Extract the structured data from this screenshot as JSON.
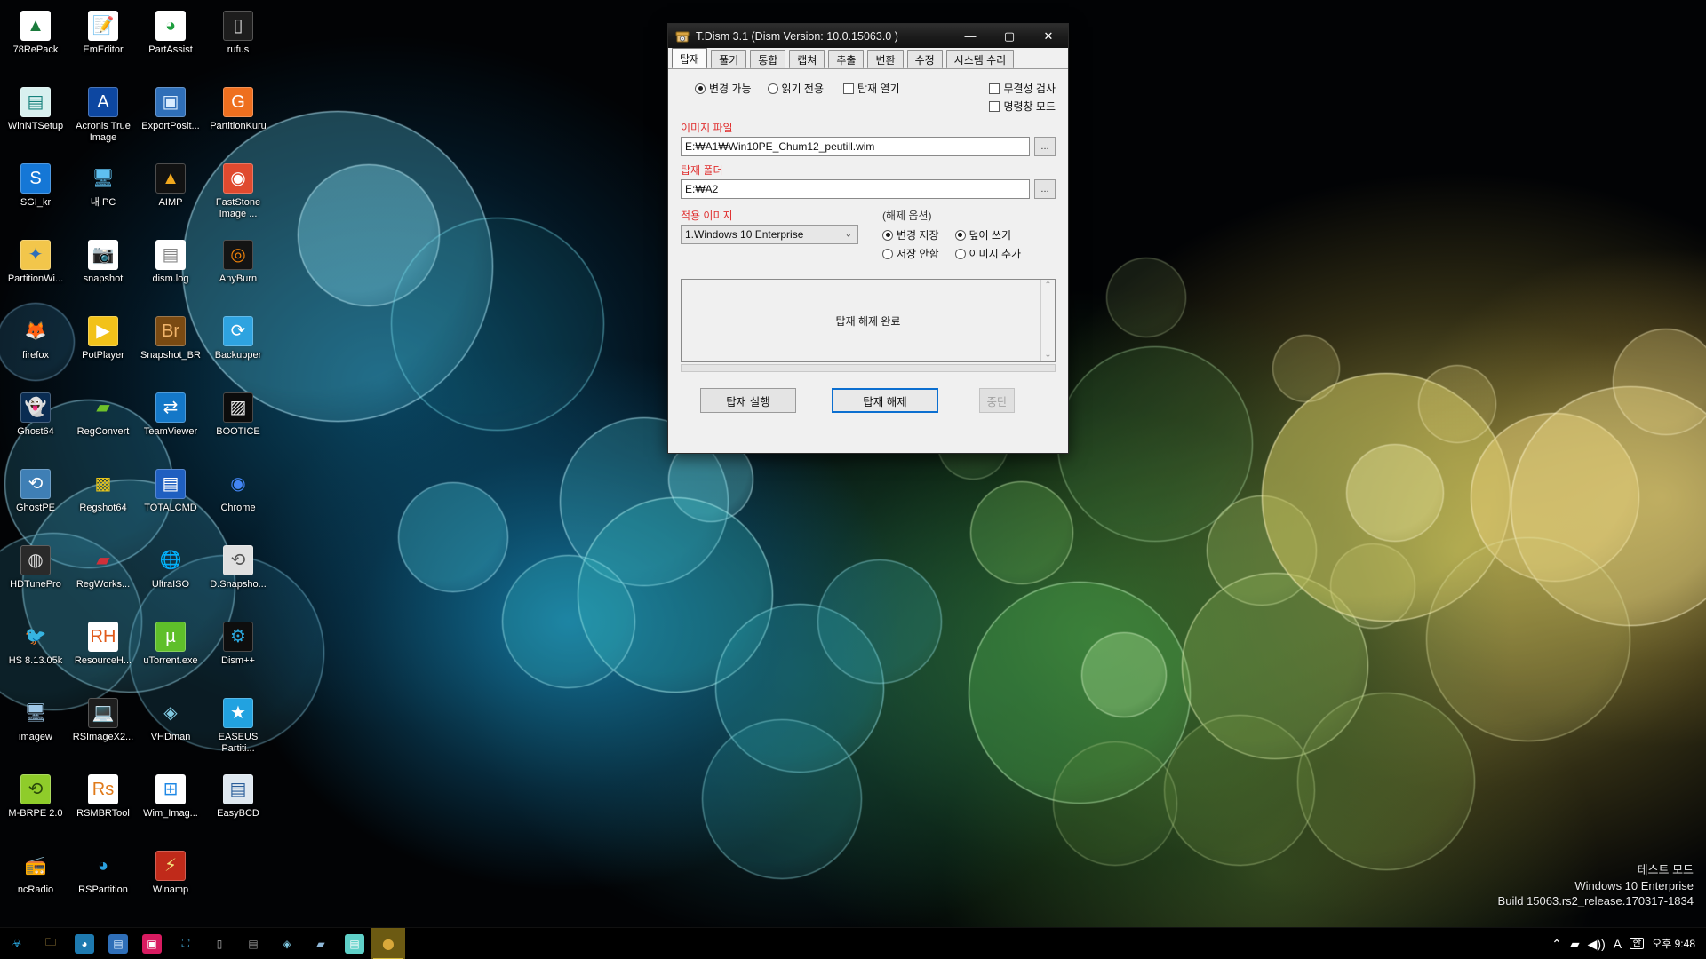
{
  "desktop": {
    "icons": [
      {
        "label": "78RePack",
        "icon": "triangle-logo-icon",
        "bg": "#ffffff",
        "fg": "#1b7a3c",
        "glyph": "▲"
      },
      {
        "label": "EmEditor",
        "icon": "notepad-pencil-icon",
        "bg": "#ffffff",
        "fg": "#2a5ea8",
        "glyph": "📝"
      },
      {
        "label": "PartAssist",
        "icon": "partition-pie-icon",
        "bg": "#ffffff",
        "fg": "#1e9e3e",
        "glyph": "◕"
      },
      {
        "label": "rufus",
        "icon": "usb-drive-icon",
        "bg": "#1d1d1d",
        "fg": "#dddddd",
        "glyph": "▯"
      },
      {
        "label": "WinNTSetup",
        "icon": "setup-book-icon",
        "bg": "#d8f0ef",
        "fg": "#17827d",
        "glyph": "▤"
      },
      {
        "label": "Acronis True Image",
        "icon": "acronis-a-icon",
        "bg": "#0d47a1",
        "fg": "#ffffff",
        "glyph": "A"
      },
      {
        "label": "ExportPosit...",
        "icon": "monitor-window-icon",
        "bg": "#2f6fb8",
        "fg": "#d8ecff",
        "glyph": "▣"
      },
      {
        "label": "PartitionKuru",
        "icon": "gparted-g-icon",
        "bg": "#ee6f1f",
        "fg": "#ffffff",
        "glyph": "G"
      },
      {
        "label": "SGI_kr",
        "icon": "sgi-s-circle-icon",
        "bg": "#1577d6",
        "fg": "#ffffff",
        "glyph": "S"
      },
      {
        "label": "내 PC",
        "icon": "this-pc-icon",
        "bg": "transparent",
        "fg": "#5fc0f0",
        "glyph": "🖥"
      },
      {
        "label": "AIMP",
        "icon": "aimp-triangle-icon",
        "bg": "#121212",
        "fg": "#f2a81d",
        "glyph": "▲"
      },
      {
        "label": "FastStone Image ...",
        "icon": "faststone-eye-icon",
        "bg": "#e04a2f",
        "fg": "#ffffff",
        "glyph": "◉"
      },
      {
        "label": "PartitionWi...",
        "icon": "partition-wizard-icon",
        "bg": "#f2c64b",
        "fg": "#2f6fb8",
        "glyph": "✦"
      },
      {
        "label": "snapshot",
        "icon": "snapshot-camera-icon",
        "bg": "#ffffff",
        "fg": "#2a3f8f",
        "glyph": "📷"
      },
      {
        "label": "dism.log",
        "icon": "text-log-file-icon",
        "bg": "#ffffff",
        "fg": "#888888",
        "glyph": "▤"
      },
      {
        "label": "AnyBurn",
        "icon": "anyburn-disc-icon",
        "bg": "#141414",
        "fg": "#f0820a",
        "glyph": "◎"
      },
      {
        "label": "firefox",
        "icon": "firefox-icon",
        "bg": "transparent",
        "fg": "#f08020",
        "glyph": "🦊"
      },
      {
        "label": "PotPlayer",
        "icon": "potplayer-play-icon",
        "bg": "#f2c21a",
        "fg": "#ffffff",
        "glyph": "▶"
      },
      {
        "label": "Snapshot_BR",
        "icon": "bridge-br-icon",
        "bg": "#7a4a12",
        "fg": "#f2b46a",
        "glyph": "Br"
      },
      {
        "label": "Backupper",
        "icon": "backupper-icon",
        "bg": "#2ea3e0",
        "fg": "#ffffff",
        "glyph": "⟳"
      },
      {
        "label": "Ghost64",
        "icon": "ghost-icon",
        "bg": "#0a2c52",
        "fg": "#f2f2d0",
        "glyph": "👻"
      },
      {
        "label": "RegConvert",
        "icon": "reg-cubes-icon",
        "bg": "transparent",
        "fg": "#6fc12a",
        "glyph": "▰"
      },
      {
        "label": "TeamViewer",
        "icon": "teamviewer-icon",
        "bg": "#1478c8",
        "fg": "#ffffff",
        "glyph": "⇄"
      },
      {
        "label": "BOOTICE",
        "icon": "bootice-disk-icon",
        "bg": "#0c0c0c",
        "fg": "#e8e8e8",
        "glyph": "▨"
      },
      {
        "label": "GhostPE",
        "icon": "ghostpe-drive-icon",
        "bg": "#3f7fb5",
        "fg": "#ffffff",
        "glyph": "⟲"
      },
      {
        "label": "Regshot64",
        "icon": "regshot-icon",
        "bg": "transparent",
        "fg": "#e8c41a",
        "glyph": "▩"
      },
      {
        "label": "TOTALCMD",
        "icon": "totalcmd-floppy-icon",
        "bg": "#1f5fc0",
        "fg": "#ffffff",
        "glyph": "▤"
      },
      {
        "label": "Chrome",
        "icon": "chrome-icon",
        "bg": "transparent",
        "fg": "#4285f4",
        "glyph": "◉"
      },
      {
        "label": "HDTunePro",
        "icon": "hdtune-disk-icon",
        "bg": "#2a2a2a",
        "fg": "#d8d8d8",
        "glyph": "◍"
      },
      {
        "label": "RegWorks...",
        "icon": "regworkshop-icon",
        "bg": "transparent",
        "fg": "#d0303a",
        "glyph": "▰"
      },
      {
        "label": "UltraISO",
        "icon": "ultraiso-globe-icon",
        "bg": "transparent",
        "fg": "#1e88e5",
        "glyph": "🌐"
      },
      {
        "label": "D.Snapsho...",
        "icon": "drive-snapshot-icon",
        "bg": "#e0e0e0",
        "fg": "#555555",
        "glyph": "⟲"
      },
      {
        "label": "HS 8.13.05k",
        "icon": "hs-bird-icon",
        "bg": "transparent",
        "fg": "#a050c8",
        "glyph": "🐦"
      },
      {
        "label": "ResourceH...",
        "icon": "resource-hacker-icon",
        "bg": "#ffffff",
        "fg": "#e05a1a",
        "glyph": "RH"
      },
      {
        "label": "uTorrent.exe",
        "icon": "utorrent-icon",
        "bg": "#5fbf2a",
        "fg": "#ffffff",
        "glyph": "µ"
      },
      {
        "label": "Dism++",
        "icon": "dismpp-gears-icon",
        "bg": "#0e0e0e",
        "fg": "#2aa8e0",
        "glyph": "⚙"
      },
      {
        "label": "imagew",
        "icon": "imagew-monitor-icon",
        "bg": "transparent",
        "fg": "#9fc8e8",
        "glyph": "🖥"
      },
      {
        "label": "RSImageX2...",
        "icon": "rsimagex-laptop-icon",
        "bg": "#1e1e1e",
        "fg": "#7fb8e8",
        "glyph": "💻"
      },
      {
        "label": "VHDman",
        "icon": "vhdman-icon",
        "bg": "transparent",
        "fg": "#7fc8e0",
        "glyph": "◈"
      },
      {
        "label": "EASEUS Partiti...",
        "icon": "easeus-partition-icon",
        "bg": "#22a2e0",
        "fg": "#ffffff",
        "glyph": "★"
      },
      {
        "label": "M-BRPE 2.0",
        "icon": "mbrpe-disk-icon",
        "bg": "#8fcc2a",
        "fg": "#2a4a0a",
        "glyph": "⟲"
      },
      {
        "label": "RSMBRTool",
        "icon": "rsmbr-rs-icon",
        "bg": "#ffffff",
        "fg": "#e07a1a",
        "glyph": "Rs"
      },
      {
        "label": "Wim_Imag...",
        "icon": "wim-windows-icon",
        "bg": "#ffffff",
        "fg": "#1e88e5",
        "glyph": "⊞"
      },
      {
        "label": "EasyBCD",
        "icon": "easybcd-icon",
        "bg": "#dfe8f0",
        "fg": "#2a5e9a",
        "glyph": "▤"
      },
      {
        "label": "ncRadio",
        "icon": "gramophone-icon",
        "bg": "transparent",
        "fg": "#c8913a",
        "glyph": "📻"
      },
      {
        "label": "RSPartition",
        "icon": "rspartition-icon",
        "bg": "transparent",
        "fg": "#2aa0e0",
        "glyph": "◕"
      },
      {
        "label": "Winamp",
        "icon": "winamp-icon",
        "bg": "#c02a1a",
        "fg": "#f2e07a",
        "glyph": "⚡"
      }
    ],
    "watermark": {
      "line1": "테스트 모드",
      "line2": "Windows 10 Enterprise",
      "line3": "Build 15063.rs2_release.170317-1834"
    }
  },
  "taskbar": {
    "items": [
      {
        "name": "biohazard-icon",
        "glyph": "☣",
        "bg": "transparent",
        "fg": "#2aa8e0",
        "active": false
      },
      {
        "name": "file-explorer-icon",
        "glyph": "🗀",
        "bg": "transparent",
        "fg": "#f2c45a",
        "active": false
      },
      {
        "name": "q-dir-icon",
        "glyph": "◕",
        "bg": "#1e7ab0",
        "fg": "#ffffff",
        "active": false
      },
      {
        "name": "control-panel-icon",
        "glyph": "▤",
        "bg": "#2f6fb8",
        "fg": "#d8ecff",
        "active": false
      },
      {
        "name": "monitor-pink-icon",
        "glyph": "▣",
        "bg": "#d81b60",
        "fg": "#ffffff",
        "active": false
      },
      {
        "name": "selection-tool-icon",
        "glyph": "⛶",
        "bg": "transparent",
        "fg": "#4fc3f7",
        "active": false
      },
      {
        "name": "usb-device-icon",
        "glyph": "▯",
        "bg": "transparent",
        "fg": "#b0b0b0",
        "active": false
      },
      {
        "name": "drive-device-icon",
        "glyph": "▤",
        "bg": "transparent",
        "fg": "#9a9a9a",
        "active": false
      },
      {
        "name": "vhd-tool-icon",
        "glyph": "◈",
        "bg": "transparent",
        "fg": "#7fc8e0",
        "active": false
      },
      {
        "name": "network-disk-icon",
        "glyph": "▰",
        "bg": "transparent",
        "fg": "#8fb8d8",
        "active": false
      },
      {
        "name": "notepad-icon",
        "glyph": "▤",
        "bg": "#5fd0c8",
        "fg": "#ffffff",
        "active": false
      },
      {
        "name": "tdism-icon",
        "glyph": "⬤",
        "bg": "transparent",
        "fg": "#d8a83a",
        "active": true
      }
    ],
    "tray": {
      "chevron": "⌃",
      "battery": "▰",
      "volume": "◀))",
      "language_a": "A",
      "ime": "한",
      "time": "오후 9:48"
    }
  },
  "window": {
    "title": "T.Dism 3.1 (Dism Version: 10.0.15063.0 )",
    "icon": "tdism-app-icon",
    "controls": {
      "minimize": "—",
      "maximize": "▢",
      "close": "✕"
    },
    "tabs": [
      {
        "label": "탑재",
        "selected": true
      },
      {
        "label": "풀기",
        "selected": false
      },
      {
        "label": "통합",
        "selected": false
      },
      {
        "label": "캡쳐",
        "selected": false
      },
      {
        "label": "추출",
        "selected": false
      },
      {
        "label": "변환",
        "selected": false
      },
      {
        "label": "수정",
        "selected": false
      },
      {
        "label": "시스템 수리",
        "selected": false
      }
    ],
    "mount_mode": {
      "writable": {
        "label": "변경 가능",
        "checked": true
      },
      "readonly": {
        "label": "읽기 전용",
        "checked": false
      },
      "open_mount": {
        "label": "탑재 열기",
        "checked": false
      }
    },
    "extra_checks": {
      "integrity": {
        "label": "무결성 검사",
        "checked": false
      },
      "cmd_mode": {
        "label": "명령창 모드",
        "checked": false
      }
    },
    "image_file": {
      "label": "이미지 파일",
      "value": "E:₩A1₩Win10PE_Chum12_peutill.wim",
      "browse": "..."
    },
    "mount_folder": {
      "label": "탑재 폴더",
      "value": "E:₩A2",
      "browse": "..."
    },
    "apply_image": {
      "label": "적용 이미지",
      "selected": "1.Windows 10 Enterprise",
      "chevron": "⌄"
    },
    "unmount_options": {
      "title": "(해제 옵션)",
      "save_changes": {
        "label": "변경 저장",
        "checked": true
      },
      "no_save": {
        "label": "저장 안함",
        "checked": false
      },
      "overwrite": {
        "label": "덮어 쓰기",
        "checked": true
      },
      "add_image": {
        "label": "이미지 추가",
        "checked": false
      }
    },
    "log": {
      "message": "탑재 해제 완료",
      "scroll_up": "⌃",
      "scroll_down": "⌄"
    },
    "buttons": {
      "mount": {
        "label": "탑재 실행",
        "state": "normal"
      },
      "unmount": {
        "label": "탑재 해제",
        "state": "primary"
      },
      "stop": {
        "label": "중단",
        "state": "disabled"
      }
    },
    "accent_color": "#0c6fd0",
    "label_color": "#e03030"
  }
}
